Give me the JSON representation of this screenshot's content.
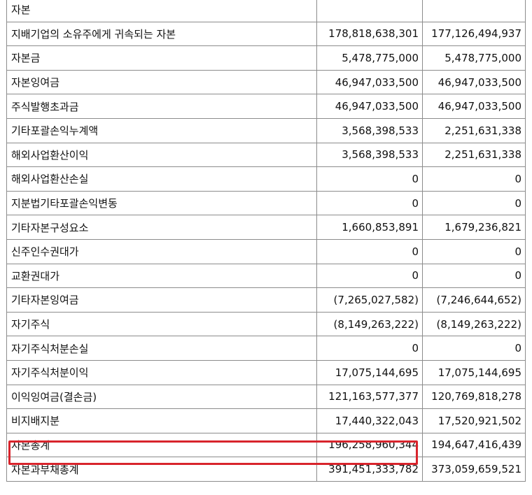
{
  "table": {
    "rows": [
      {
        "label": "자본",
        "indent": 0,
        "current": "",
        "prior": ""
      },
      {
        "label": "지배기업의 소유주에게 귀속되는 자본",
        "indent": 1,
        "current": "178,818,638,301",
        "prior": "177,126,494,937"
      },
      {
        "label": "자본금",
        "indent": 2,
        "current": "5,478,775,000",
        "prior": "5,478,775,000"
      },
      {
        "label": "자본잉여금",
        "indent": 2,
        "current": "46,947,033,500",
        "prior": "46,947,033,500"
      },
      {
        "label": "주식발행초과금",
        "indent": 3,
        "current": "46,947,033,500",
        "prior": "46,947,033,500"
      },
      {
        "label": "기타포괄손익누계액",
        "indent": 2,
        "current": "3,568,398,533",
        "prior": "2,251,631,338"
      },
      {
        "label": "해외사업환산이익",
        "indent": 3,
        "current": "3,568,398,533",
        "prior": "2,251,631,338"
      },
      {
        "label": "해외사업환산손실",
        "indent": 3,
        "current": "0",
        "prior": "0"
      },
      {
        "label": "지분법기타포괄손익변동",
        "indent": 3,
        "current": "0",
        "prior": "0"
      },
      {
        "label": "기타자본구성요소",
        "indent": 2,
        "current": "1,660,853,891",
        "prior": "1,679,236,821"
      },
      {
        "label": "신주인수권대가",
        "indent": 3,
        "current": "0",
        "prior": "0"
      },
      {
        "label": "교환권대가",
        "indent": 3,
        "current": "0",
        "prior": "0"
      },
      {
        "label": "기타자본잉여금",
        "indent": 3,
        "current": "(7,265,027,582)",
        "prior": "(7,246,644,652)"
      },
      {
        "label": "자기주식",
        "indent": 3,
        "current": "(8,149,263,222)",
        "prior": "(8,149,263,222)"
      },
      {
        "label": "자기주식처분손실",
        "indent": 3,
        "current": "0",
        "prior": "0"
      },
      {
        "label": "자기주식처분이익",
        "indent": 3,
        "current": "17,075,144,695",
        "prior": "17,075,144,695"
      },
      {
        "label": "이익잉여금(결손금)",
        "indent": 2,
        "current": "121,163,577,377",
        "prior": "120,769,818,278"
      },
      {
        "label": "비지배지분",
        "indent": 1,
        "current": "17,440,322,043",
        "prior": "17,520,921,502"
      },
      {
        "label": "자본총계",
        "indent": 1,
        "current": "196,258,960,344",
        "prior": "194,647,416,439"
      },
      {
        "label": "자본과부채총계",
        "indent": 0,
        "current": "391,451,333,782",
        "prior": "373,059,659,521"
      }
    ]
  },
  "highlight": {
    "row_label": "자본총계",
    "color": "#d8242c"
  },
  "colors": {
    "grid": "#8c8c8c",
    "text": "#111111",
    "background": "#ffffff"
  }
}
